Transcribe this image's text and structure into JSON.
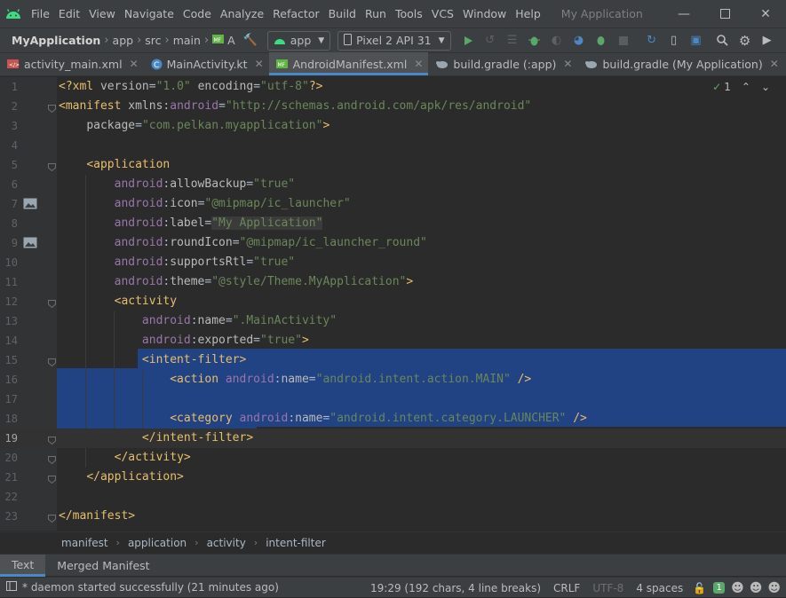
{
  "app": {
    "title": "My Application",
    "project": "MyApplication"
  },
  "menu": [
    "File",
    "Edit",
    "View",
    "Navigate",
    "Code",
    "Analyze",
    "Refactor",
    "Build",
    "Run",
    "Tools",
    "VCS",
    "Window",
    "Help"
  ],
  "breadcrumb": [
    "app",
    "src",
    "main",
    "A"
  ],
  "toolbar": {
    "run_config": "app",
    "device": "Pixel 2 API 31"
  },
  "tabs": [
    {
      "label": "activity_main.xml",
      "icon": "layout-file-icon"
    },
    {
      "label": "MainActivity.kt",
      "icon": "kotlin-class-icon"
    },
    {
      "label": "AndroidManifest.xml",
      "icon": "manifest-file-icon",
      "active": true
    },
    {
      "label": "build.gradle (:app)",
      "icon": "gradle-icon"
    },
    {
      "label": "build.gradle (My Application)",
      "icon": "gradle-icon"
    }
  ],
  "editor": {
    "inspection_count": "1",
    "line_numbers": [
      "1",
      "2",
      "3",
      "4",
      "5",
      "6",
      "7",
      "8",
      "9",
      "10",
      "11",
      "12",
      "13",
      "14",
      "15",
      "16",
      "17",
      "18",
      "19",
      "20",
      "21",
      "22",
      "23"
    ],
    "current_line": 19,
    "lines": [
      [
        [
          "t-pun",
          "<?"
        ],
        [
          "t-tag",
          "xml "
        ],
        [
          "t-attr",
          "version"
        ],
        [
          "t-txt",
          "="
        ],
        [
          "t-val",
          "\"1.0\""
        ],
        [
          "t-txt",
          " "
        ],
        [
          "t-attr",
          "encoding"
        ],
        [
          "t-txt",
          "="
        ],
        [
          "t-val",
          "\"utf-8\""
        ],
        [
          "t-pun",
          "?>"
        ]
      ],
      [
        [
          "t-tag",
          "<manifest "
        ],
        [
          "t-attr",
          "xmlns"
        ],
        [
          "t-txt",
          ":"
        ],
        [
          "t-ns",
          "android"
        ],
        [
          "t-txt",
          "="
        ],
        [
          "t-val",
          "\"http://schemas.android.com/apk/res/android\""
        ]
      ],
      [
        [
          "t-txt",
          "    "
        ],
        [
          "t-attr",
          "package"
        ],
        [
          "t-txt",
          "="
        ],
        [
          "t-val",
          "\"com.pelkan.myapplication\""
        ],
        [
          "t-tag",
          ">"
        ]
      ],
      [],
      [
        [
          "t-txt",
          "    "
        ],
        [
          "t-tag",
          "<application"
        ]
      ],
      [
        [
          "t-txt",
          "        "
        ],
        [
          "t-ns",
          "android"
        ],
        [
          "t-txt",
          ":"
        ],
        [
          "t-attr",
          "allowBackup"
        ],
        [
          "t-txt",
          "="
        ],
        [
          "t-val",
          "\"true\""
        ]
      ],
      [
        [
          "t-txt",
          "        "
        ],
        [
          "t-ns",
          "android"
        ],
        [
          "t-txt",
          ":"
        ],
        [
          "t-attr",
          "icon"
        ],
        [
          "t-txt",
          "="
        ],
        [
          "t-val",
          "\"@mipmap/ic_launcher\""
        ]
      ],
      [
        [
          "t-txt",
          "        "
        ],
        [
          "t-ns",
          "android"
        ],
        [
          "t-txt",
          ":"
        ],
        [
          "t-attr",
          "label"
        ],
        [
          "t-txt",
          "="
        ],
        [
          "t-val t-strbg",
          "\"My Application\""
        ]
      ],
      [
        [
          "t-txt",
          "        "
        ],
        [
          "t-ns",
          "android"
        ],
        [
          "t-txt",
          ":"
        ],
        [
          "t-attr",
          "roundIcon"
        ],
        [
          "t-txt",
          "="
        ],
        [
          "t-val",
          "\"@mipmap/ic_launcher_round\""
        ]
      ],
      [
        [
          "t-txt",
          "        "
        ],
        [
          "t-ns",
          "android"
        ],
        [
          "t-txt",
          ":"
        ],
        [
          "t-attr",
          "supportsRtl"
        ],
        [
          "t-txt",
          "="
        ],
        [
          "t-val",
          "\"true\""
        ]
      ],
      [
        [
          "t-txt",
          "        "
        ],
        [
          "t-ns",
          "android"
        ],
        [
          "t-txt",
          ":"
        ],
        [
          "t-attr",
          "theme"
        ],
        [
          "t-txt",
          "="
        ],
        [
          "t-val",
          "\"@style/Theme.MyApplication\""
        ],
        [
          "t-tag",
          ">"
        ]
      ],
      [
        [
          "t-txt",
          "        "
        ],
        [
          "t-tag",
          "<activity"
        ]
      ],
      [
        [
          "t-txt",
          "            "
        ],
        [
          "t-ns",
          "android"
        ],
        [
          "t-txt",
          ":"
        ],
        [
          "t-attr",
          "name"
        ],
        [
          "t-txt",
          "="
        ],
        [
          "t-val",
          "\".MainActivity\""
        ]
      ],
      [
        [
          "t-txt",
          "            "
        ],
        [
          "t-ns",
          "android"
        ],
        [
          "t-txt",
          ":"
        ],
        [
          "t-attr",
          "exported"
        ],
        [
          "t-txt",
          "="
        ],
        [
          "t-val",
          "\"true\""
        ],
        [
          "t-tag",
          ">"
        ]
      ],
      [
        [
          "t-txt",
          "            "
        ],
        [
          "t-tag",
          "<intent-filter>"
        ]
      ],
      [
        [
          "t-txt",
          "                "
        ],
        [
          "t-tag",
          "<action "
        ],
        [
          "t-ns",
          "android"
        ],
        [
          "t-txt",
          ":"
        ],
        [
          "t-attr",
          "name"
        ],
        [
          "t-txt",
          "="
        ],
        [
          "t-val",
          "\"android.intent.action.MAIN\""
        ],
        [
          "t-txt",
          " "
        ],
        [
          "t-tag",
          "/>"
        ]
      ],
      [],
      [
        [
          "t-txt",
          "                "
        ],
        [
          "t-tag",
          "<category "
        ],
        [
          "t-ns",
          "android"
        ],
        [
          "t-txt",
          ":"
        ],
        [
          "t-attr",
          "name"
        ],
        [
          "t-txt",
          "="
        ],
        [
          "t-val",
          "\"android.intent.category.LAUNCHER\""
        ],
        [
          "t-txt",
          " "
        ],
        [
          "t-tag",
          "/>"
        ]
      ],
      [
        [
          "t-txt",
          "            "
        ],
        [
          "t-tag",
          "</intent-filter>"
        ]
      ],
      [
        [
          "t-txt",
          "        "
        ],
        [
          "t-tag",
          "</activity>"
        ]
      ],
      [
        [
          "t-txt",
          "    "
        ],
        [
          "t-tag",
          "</application>"
        ]
      ],
      [],
      [
        [
          "t-tag",
          "</manifest>"
        ]
      ]
    ]
  },
  "code_breadcrumb": [
    "manifest",
    "application",
    "activity",
    "intent-filter"
  ],
  "bottom_tabs": [
    {
      "label": "Text",
      "active": true
    },
    {
      "label": "Merged Manifest"
    }
  ],
  "status": {
    "message": "* daemon started successfully (21 minutes ago)",
    "position": "19:29 (192 chars, 4 line breaks)",
    "line_sep": "CRLF",
    "encoding": "UTF-8",
    "indent": "4 spaces",
    "notifications": "1"
  },
  "colors": {
    "accent": "#4a88c7",
    "selection": "#214283",
    "run_green": "#59a869",
    "android_green": "#3ddc84"
  }
}
